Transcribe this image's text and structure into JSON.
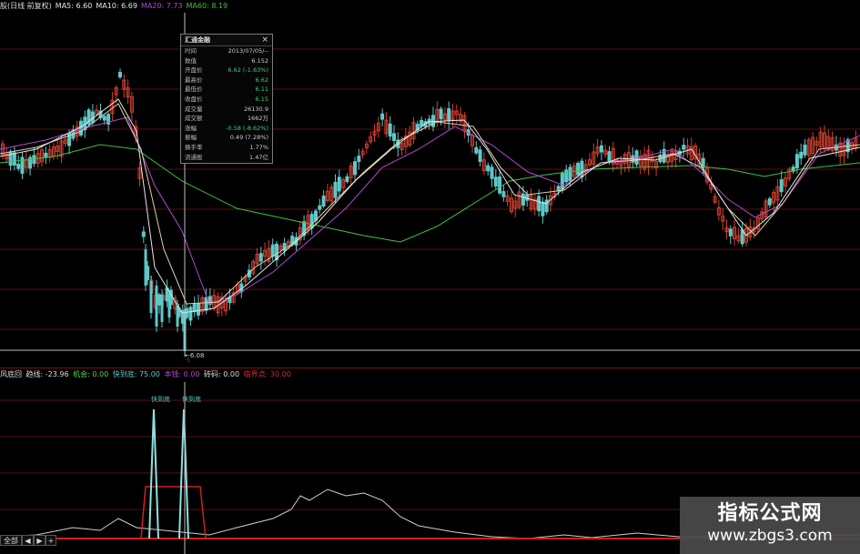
{
  "legend": {
    "prefix": "股(日线 前复权)",
    "items": [
      {
        "label": "MA5: 6.60",
        "color": "#e6e6e6"
      },
      {
        "label": "MA10: 6.69",
        "color": "#e6e6e6"
      },
      {
        "label": "MA20: 7.73",
        "color": "#b04ad0"
      },
      {
        "label": "MA60: 8.19",
        "color": "#40c040"
      }
    ]
  },
  "info_box": {
    "title": "汇通金融",
    "close": "×",
    "rows": [
      {
        "key": "时间",
        "value": "2013/07/05/--",
        "color": "#cccccc"
      },
      {
        "key": "数值",
        "value": "6.152",
        "color": "#cccccc"
      },
      {
        "key": "开盘价",
        "value": "6.62 (-1.63%)",
        "color": "#3fd07a"
      },
      {
        "key": "最高价",
        "value": "6.62",
        "color": "#3fd07a"
      },
      {
        "key": "最低价",
        "value": "6.11",
        "color": "#3fd07a"
      },
      {
        "key": "收盘价",
        "value": "6.15",
        "color": "#3fd07a"
      },
      {
        "key": "成交量",
        "value": "26130.9",
        "color": "#cccccc"
      },
      {
        "key": "成交额",
        "value": "1662万",
        "color": "#cccccc"
      },
      {
        "key": "涨幅",
        "value": "-0.58 (-8.62%)",
        "color": "#3fd07a"
      },
      {
        "key": "振幅",
        "value": "0.49 (7.28%)",
        "color": "#cccccc"
      },
      {
        "key": "换手率",
        "value": "1.77%",
        "color": "#cccccc"
      },
      {
        "key": "流通股",
        "value": "1.47亿",
        "color": "#cccccc"
      }
    ]
  },
  "low_label": "←6.08",
  "cursor_marker": "5",
  "indicator": {
    "items": [
      {
        "label": "风底回",
        "color": "#dddddd"
      },
      {
        "label": "趋线: -23.96",
        "color": "#dddddd"
      },
      {
        "label": "机会: 0.00",
        "color": "#5ad05a"
      },
      {
        "label": "快到底: 75.00",
        "color": "#5ec8c8"
      },
      {
        "label": "本钱: 0.00",
        "color": "#b04ad0"
      },
      {
        "label": "砖码: 0.00",
        "color": "#dddddd"
      },
      {
        "label": "临界点: 30.00",
        "color": "#d03030"
      }
    ],
    "peak_labels": [
      "快到底",
      "快到底"
    ]
  },
  "scrollbar": {
    "labels": [
      "全部",
      "◀",
      "▶",
      "+"
    ]
  },
  "watermark": {
    "title": "指标公式网",
    "url": "www.zbgs3.com"
  },
  "colors": {
    "up": "#d04030",
    "down": "#5ec8c8",
    "grid": "#5a1010",
    "ma60": "#40c040",
    "ma20": "#b04ad0",
    "ma10": "#e0d0b0",
    "ma5": "#e6e6e6"
  }
}
